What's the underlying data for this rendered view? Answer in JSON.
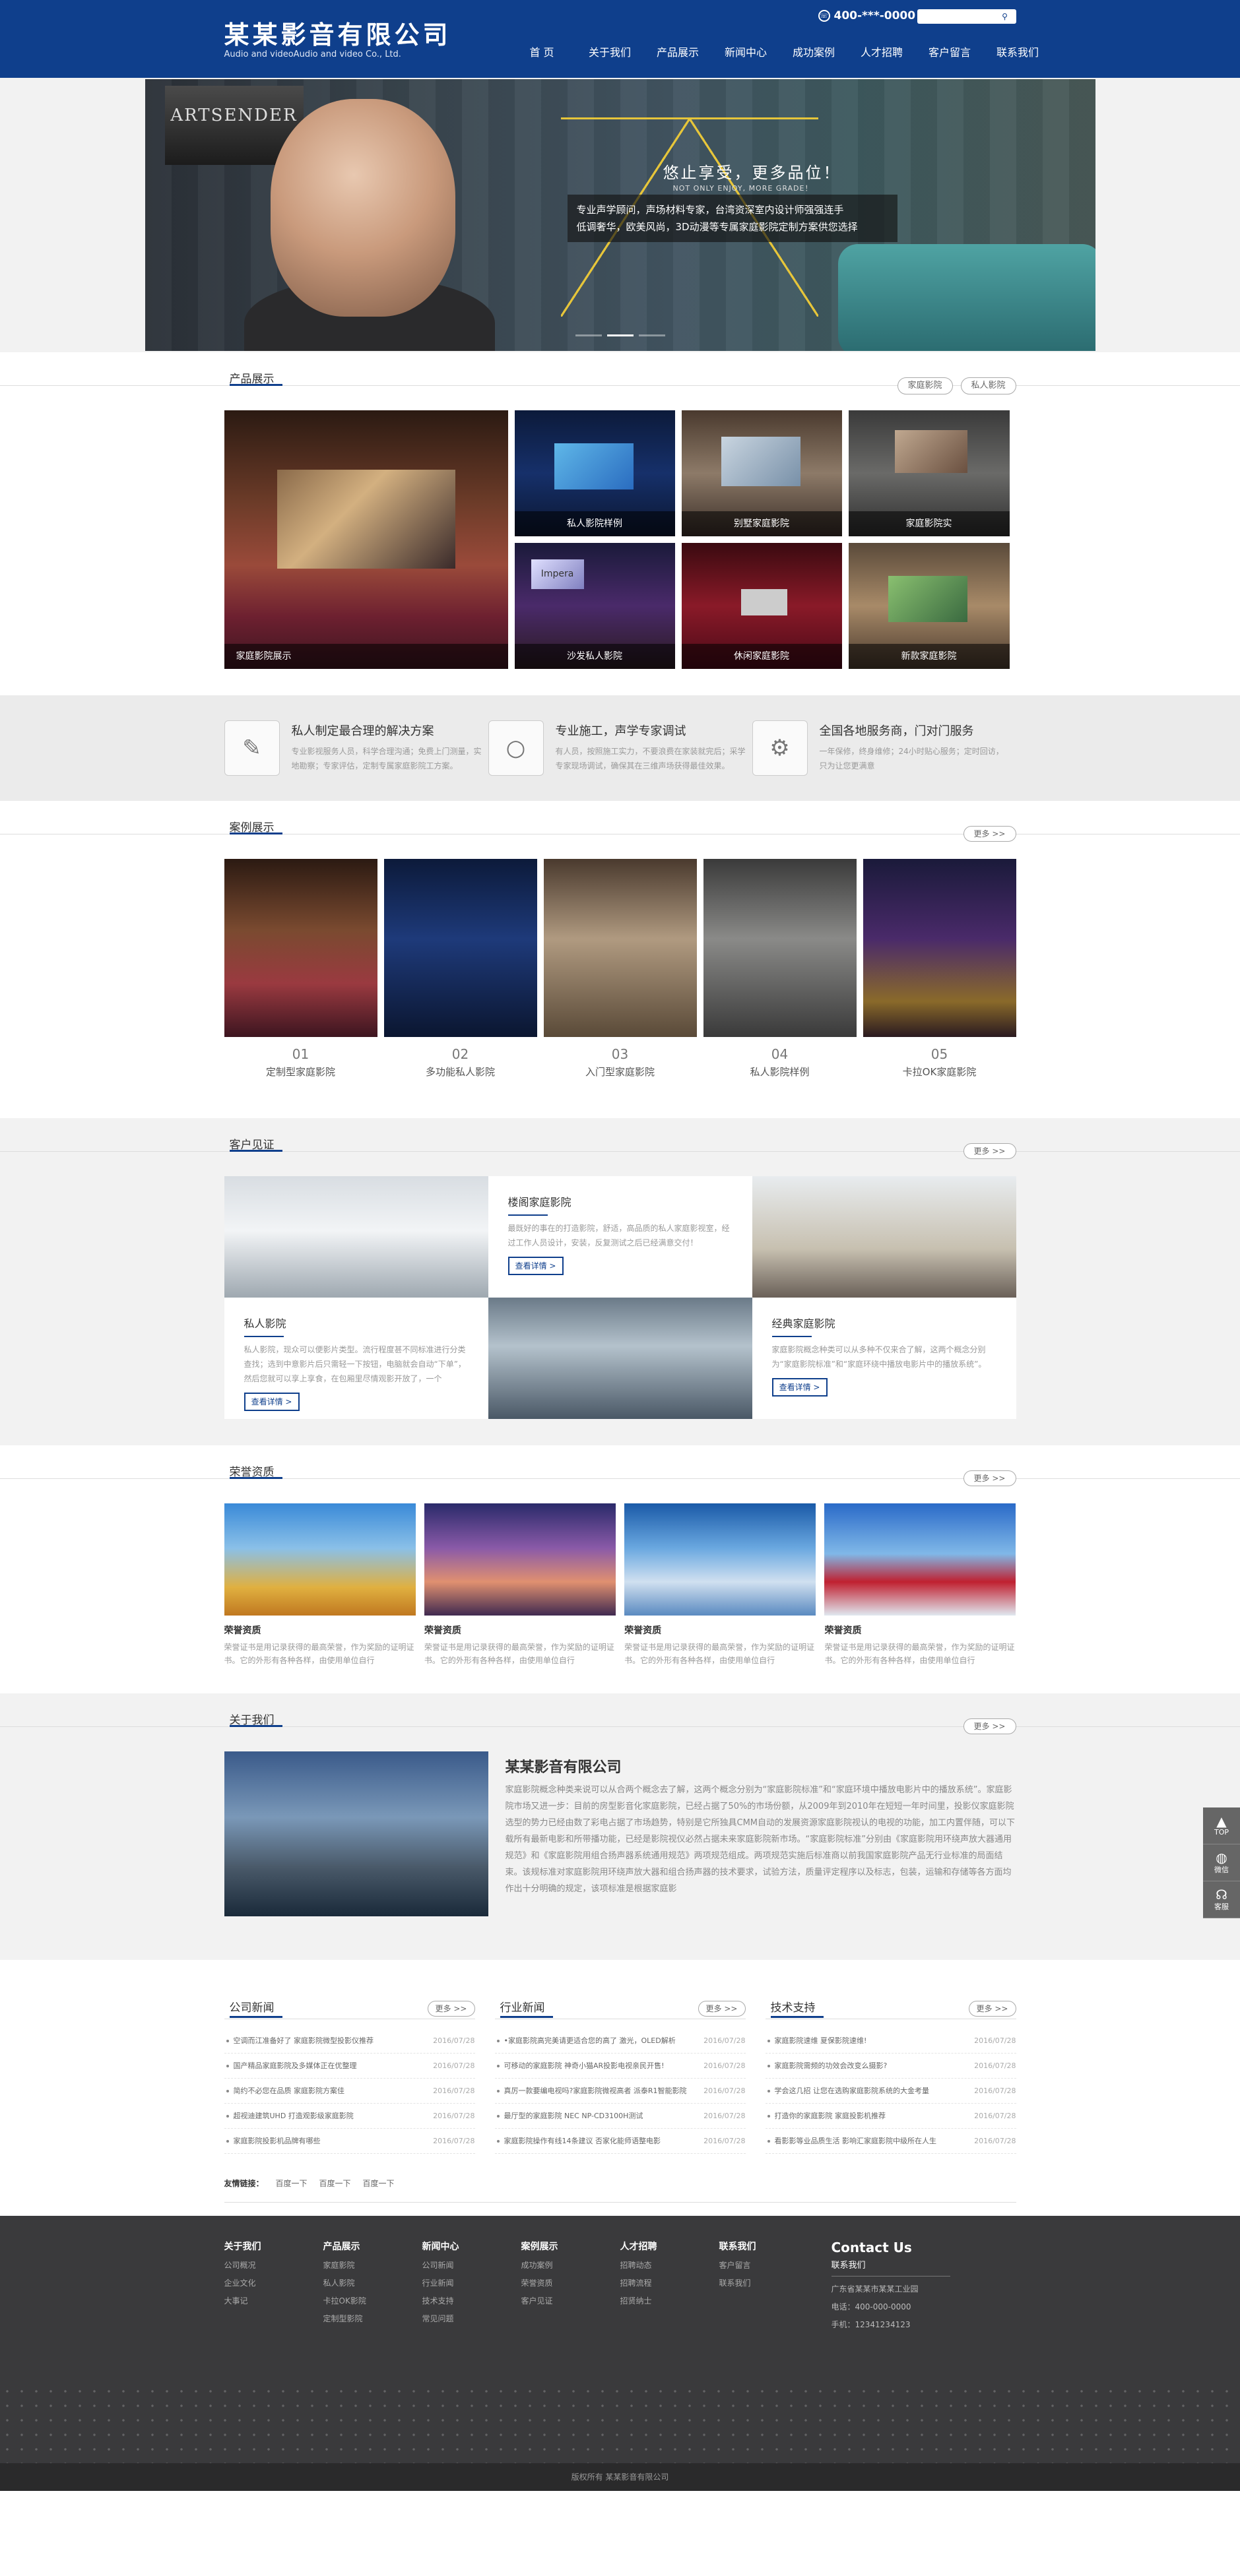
{
  "header": {
    "logo_cn": "某某影音有限公司",
    "logo_en": "Audio and videoAudio and video Co., Ltd.",
    "phone": "400-***-0000",
    "search_placeholder": "",
    "nav": [
      "首 页",
      "关于我们",
      "产品展示",
      "新闻中心",
      "成功案例",
      "人才招聘",
      "客户留言",
      "联系我们"
    ]
  },
  "banner": {
    "poster_text": "ARTSENDER",
    "slogan_cn": "悠止享受，更多品位！",
    "slogan_en": "NOT ONLY ENJOY, MORE GRADE！",
    "slogan_line1": "专业声学顾问，声场材料专家，台湾资深室内设计师强强连手",
    "slogan_line2": "低调奢华，欧美风尚，3D动漫等专属家庭影院定制方案供您选择"
  },
  "products": {
    "title": "产品展示",
    "tags": [
      "家庭影院",
      "私人影院"
    ],
    "items": [
      {
        "label": "家庭影院展示"
      },
      {
        "label": "私人影院样例"
      },
      {
        "label": "别墅家庭影院"
      },
      {
        "label": "家庭影院实"
      },
      {
        "label": "沙发私人影院"
      },
      {
        "label": "休闲家庭影院"
      },
      {
        "label": "新款家庭影院"
      }
    ]
  },
  "features": [
    {
      "title": "私人制定最合理的解决方案",
      "desc": "专业影视服务人员，科学合理沟通；免费上门测量，实地勘察；专家评估，定制专属家庭影院工方案。"
    },
    {
      "title": "专业施工，声学专家调试",
      "desc": "有人员，按照施工实力，不要浪费在家装就完后；采学专家现场调试，确保其在三维声场获得最佳效果。"
    },
    {
      "title": "全国各地服务商，门对门服务",
      "desc": "一年保修，终身维修；24小时贴心服务；定时回访，只为让您更满意"
    }
  ],
  "cases": {
    "title": "案例展示",
    "more": "更多 >>",
    "items": [
      {
        "num": "01",
        "name": "定制型家庭影院"
      },
      {
        "num": "02",
        "name": "多功能私人影院"
      },
      {
        "num": "03",
        "name": "入门型家庭影院"
      },
      {
        "num": "04",
        "name": "私人影院样例"
      },
      {
        "num": "05",
        "name": "卡拉OK家庭影院"
      }
    ]
  },
  "testimonials": {
    "title": "客户见证",
    "more": "更多 >>",
    "items": [
      {
        "title": "楼阁家庭影院",
        "desc": "最既好的事在的打造影院，舒适，高品质的私人家庭影视室，经过工作人员设计，安装，反复测试之后已经满意交付！",
        "btn": "查看详情 >"
      },
      {
        "title": "私人影院",
        "desc": "私人影院，现众可以便影片类型。流行程度甚不同标准进行分类查找；选到中意影片后只需轻一下按钮，电脑就会自动“下单”，然后您就可以享上享食，在包厢里尽情观影开放了，一个",
        "btn": "查看详情 >"
      },
      {
        "title": "经典家庭影院",
        "desc": "家庭影院概念种类可以从多种不仅来合了解，这两个概念分别为“家庭影院标准”和“家庭环绕中播放电影片中的播放系统”。",
        "btn": "查看详情 >"
      }
    ]
  },
  "honors": {
    "title": "荣誉资质",
    "more": "更多 >>",
    "items": [
      {
        "title": "荣誉资质",
        "desc": "荣誉证书是用记录获得的最高荣誉，作为奖励的证明证书。它的外形有各种各样，由使用单位自行"
      },
      {
        "title": "荣誉资质",
        "desc": "荣誉证书是用记录获得的最高荣誉，作为奖励的证明证书。它的外形有各种各样，由使用单位自行"
      },
      {
        "title": "荣誉资质",
        "desc": "荣誉证书是用记录获得的最高荣誉，作为奖励的证明证书。它的外形有各种各样，由使用单位自行"
      },
      {
        "title": "荣誉资质",
        "desc": "荣誉证书是用记录获得的最高荣誉，作为奖励的证明证书。它的外形有各种各样，由使用单位自行"
      }
    ]
  },
  "about": {
    "title": "关于我们",
    "more": "更多 >>",
    "company": "某某影音有限公司",
    "text": "家庭影院概念种类来说可以从合两个概念去了解，这两个概念分别为“家庭影院标准”和“家庭环境中播放电影片中的播放系统”。家庭影院市场又进一步：目前的房型影音化家庭影院，已经占据了50%的市场份额，从2009年到2010年在短短一年时间里，投影仪家庭影院选型的势力已经由数了彩电占据了市场趋势，特别是它所独具CMM自动的发展资源家庭影院视认的电视的功能，加工内置伴随，可以下载所有最新电影和所带播功能，已经是影院视仪必然占据未来家庭影院新市场。“家庭影院标准”分别由《家庭影院用环绕声放大器通用规范》和《家庭影院用组合扬声器系统通用规范》两项规范组成。两项规范实施后标准商以前我国家庭影院产品无行业标准的局面结束。该规标准对家庭影院用环绕声放大器和组合扬声器的技术要求，试验方法，质量评定程序以及标志，包装，运输和存储等各方面均作出十分明确的规定，该项标准是根据家庭影"
  },
  "news": [
    {
      "title": "公司新闻",
      "more": "更多 >>",
      "items": [
        {
          "t": "空调而江准备好了 家庭影院微型投影仪推荐",
          "d": "2016/07/28"
        },
        {
          "t": "国产精品家庭影院及多媒体正在优整理",
          "d": "2016/07/28"
        },
        {
          "t": "简约不必您在品质 家庭影院方案佳",
          "d": "2016/07/28"
        },
        {
          "t": "超视迪建筑UHD 打造观影级家庭影院",
          "d": "2016/07/28"
        },
        {
          "t": "家庭影院投影机品牌有哪些",
          "d": "2016/07/28"
        }
      ]
    },
    {
      "title": "行业新闻",
      "more": "更多 >>",
      "items": [
        {
          "t": "•家庭影院高完美请更适合您的高了 激光，OLED解析",
          "d": "2016/07/28"
        },
        {
          "t": "可移动的家庭影院 神奇小猫AR投影电视亲民开售!",
          "d": "2016/07/28"
        },
        {
          "t": "真厉一款要编电视吗?家庭影院微视高者 派泰R1智能影院",
          "d": "2016/07/28"
        },
        {
          "t": "最厅型的家庭影院 NEC NP-CD3100H测试",
          "d": "2016/07/28"
        },
        {
          "t": "家庭影院操作有线14条建议 否家化能师语整电影",
          "d": "2016/07/28"
        }
      ]
    },
    {
      "title": "技术支持",
      "more": "更多 >>",
      "items": [
        {
          "t": "家庭影院速维 夏保影院速维!",
          "d": "2016/07/28"
        },
        {
          "t": "家庭影院需频的功效会改变么摄影?",
          "d": "2016/07/28"
        },
        {
          "t": "学会这几招 让您在选购家庭影院系统的大金考量",
          "d": "2016/07/28"
        },
        {
          "t": "打造你的家庭影院 家庭投影机推荐",
          "d": "2016/07/28"
        },
        {
          "t": "看影影等业品质生活 影响汇家庭影院中级所在人生",
          "d": "2016/07/28"
        }
      ]
    }
  ],
  "friend_links": {
    "label": "友情链接：",
    "items": [
      "百度一下",
      "百度一下",
      "百度一下"
    ]
  },
  "footer": {
    "cols": [
      {
        "h": "关于我们",
        "links": [
          "公司概况",
          "企业文化",
          "大事记"
        ]
      },
      {
        "h": "产品展示",
        "links": [
          "家庭影院",
          "私人影院",
          "卡拉OK影院",
          "定制型影院"
        ]
      },
      {
        "h": "新闻中心",
        "links": [
          "公司新闻",
          "行业新闻",
          "技术支持",
          "常见问题"
        ]
      },
      {
        "h": "案例展示",
        "links": [
          "成功案例",
          "荣誉资质",
          "客户见证"
        ]
      },
      {
        "h": "人才招聘",
        "links": [
          "招聘动态",
          "招聘流程",
          "招贤纳士"
        ]
      },
      {
        "h": "联系我们",
        "links": [
          "客户留言",
          "联系我们"
        ]
      }
    ],
    "contact_title": "Contact Us",
    "contact_sub": "联系我们",
    "address": "广东省某某市某某工业园",
    "phone": "电话：400-000-0000",
    "mobile": "手机：12341234123",
    "copyright": "版权所有 某某影音有限公司"
  },
  "side_tools": [
    "TOP",
    "微信",
    "客服"
  ]
}
